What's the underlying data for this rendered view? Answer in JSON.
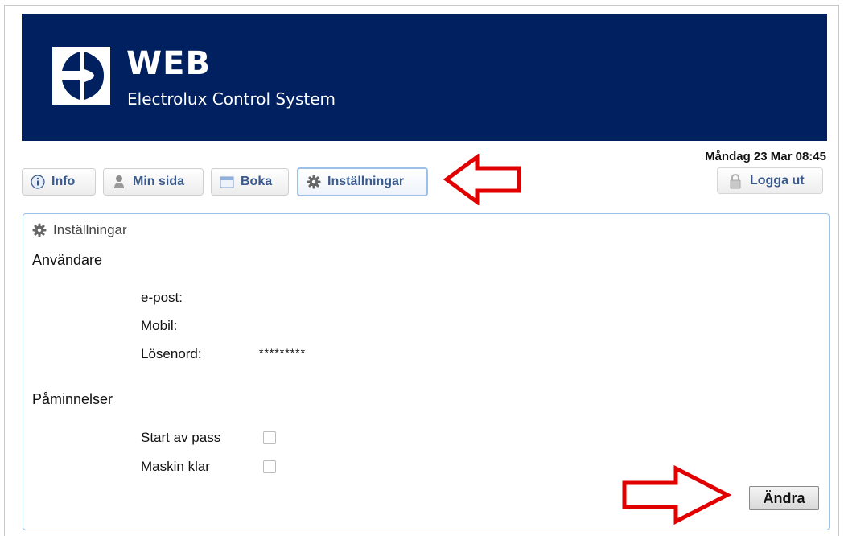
{
  "header": {
    "brand": "WEB",
    "subtitle": "Electrolux Control System"
  },
  "status": {
    "datetime": "Måndag 23 Mar 08:45"
  },
  "nav": {
    "items": [
      {
        "label": "Info",
        "icon": "info-icon"
      },
      {
        "label": "Min sida",
        "icon": "user-icon"
      },
      {
        "label": "Boka",
        "icon": "calendar-icon"
      },
      {
        "label": "Inställningar",
        "icon": "gear-icon",
        "active": true
      }
    ],
    "logout": {
      "label": "Logga ut",
      "icon": "lock-icon"
    }
  },
  "settings": {
    "title": "Inställningar",
    "user_section": {
      "heading": "Användare",
      "fields": [
        {
          "label": "e-post:",
          "value": ""
        },
        {
          "label": "Mobil:",
          "value": ""
        },
        {
          "label": "Lösenord:",
          "value": "*********"
        }
      ]
    },
    "reminders_section": {
      "heading": "Påminnelser",
      "options": [
        {
          "label": "Start av pass",
          "checked": false
        },
        {
          "label": "Maskin klar",
          "checked": false
        }
      ]
    },
    "change_button": "Ändra"
  },
  "colors": {
    "banner": "#002060",
    "annotation_arrow": "#e00000",
    "panel_border": "#9cc0e8",
    "nav_text": "#3a5a8c"
  }
}
